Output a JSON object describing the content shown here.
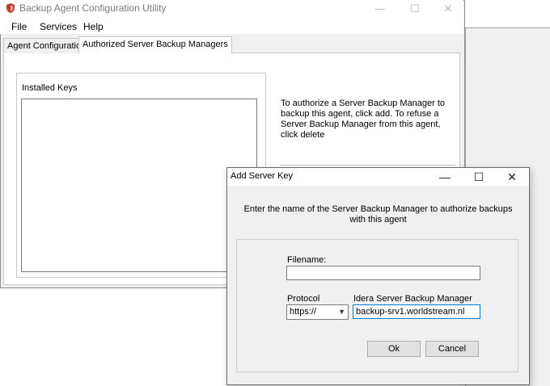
{
  "main_window": {
    "title": "Backup Agent Configuration Utility",
    "controls": {
      "minimize": "—",
      "maximize": "☐",
      "close": "✕"
    },
    "menu": [
      "File",
      "Services",
      "Help"
    ],
    "tabs": [
      "Agent Configuration",
      "Authorized Server Backup Managers"
    ],
    "group_label": "Installed Keys",
    "help_text": "To authorize a Server Backup Manager to backup this agent, click add. To refuse a Server Backup Manager from this agent, click delete"
  },
  "dialog": {
    "title": "Add Server Key",
    "controls": {
      "minimize": "—",
      "maximize": "☐",
      "close": "✕"
    },
    "instruction": "Enter the name of the Server Backup Manager to authorize backups with this agent",
    "filename_label": "Filename:",
    "filename_value": "",
    "protocol_label": "Protocol",
    "protocol_value": "https://",
    "manager_label": "Idera Server Backup Manager",
    "manager_value": "backup-srv1.worldstream.nl",
    "ok_label": "Ok",
    "cancel_label": "Cancel"
  },
  "colors": {
    "accent": "#0078d7",
    "window_bg": "#f0f0f0",
    "title_inactive": "#7a7a7a",
    "app_icon": "#c0392b"
  }
}
